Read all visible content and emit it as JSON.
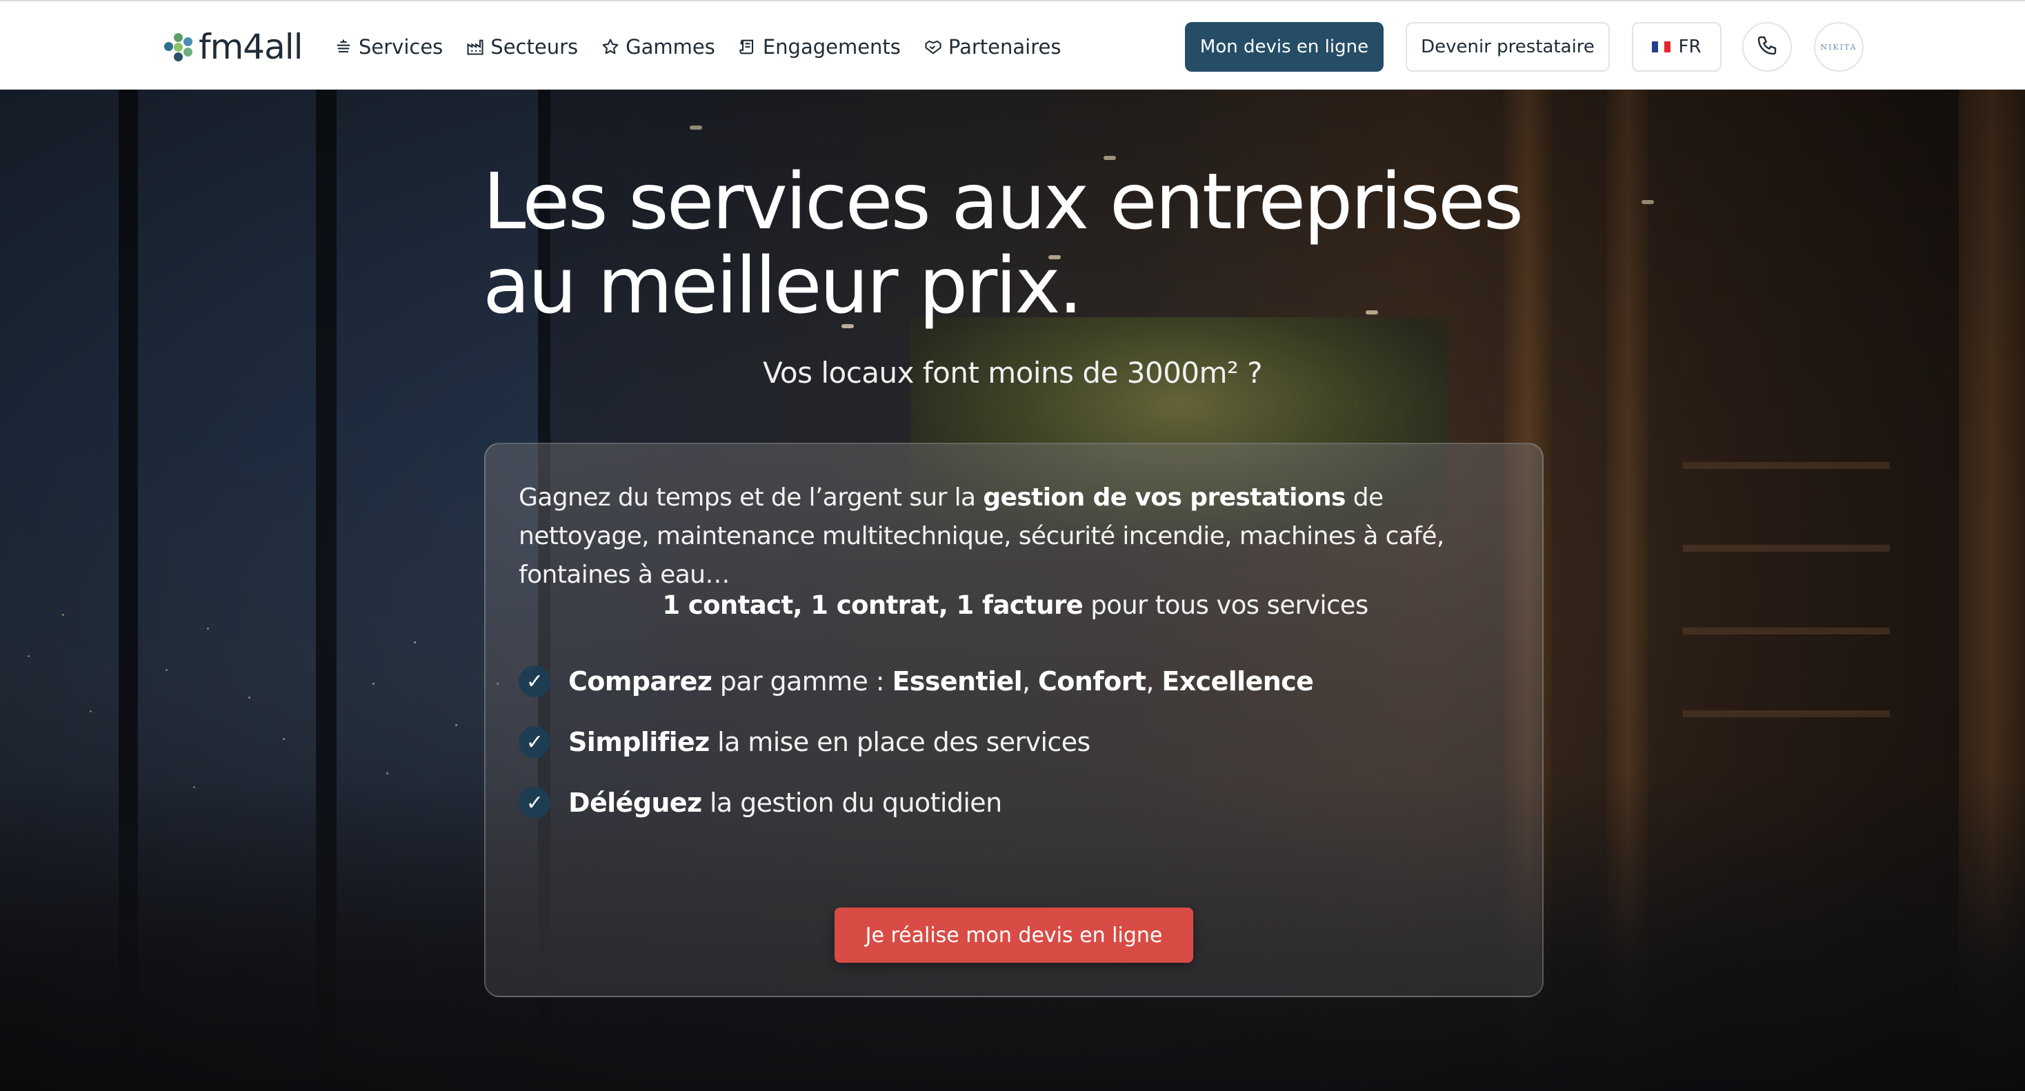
{
  "brand": {
    "name": "fm4all",
    "dot_colors": [
      "#2f6f8f",
      "#5c9f6a",
      "#8cc36a",
      "#2a4e6a",
      "#4c8fb0",
      "#6bb07a",
      "#1f3a52"
    ]
  },
  "nav": {
    "items": [
      {
        "label": "Services",
        "icon": "broom-icon"
      },
      {
        "label": "Secteurs",
        "icon": "factory-icon"
      },
      {
        "label": "Gammes",
        "icon": "star-icon"
      },
      {
        "label": "Engagements",
        "icon": "scroll-icon"
      },
      {
        "label": "Partenaires",
        "icon": "handshake-icon"
      }
    ]
  },
  "header_actions": {
    "quote_label": "Mon devis en ligne",
    "provider_label": "Devenir prestataire",
    "lang_label": "FR",
    "phone_icon": "phone-icon",
    "avatar_text": "NIKITA"
  },
  "hero": {
    "title_line1": "Les services aux entreprises",
    "title_line2": "au meilleur prix.",
    "subtitle": "Vos locaux font moins de 3000m² ?",
    "intro_part1": "Gagnez du temps et de l’argent sur la ",
    "intro_bold": "gestion de vos prestations",
    "intro_part2": " de nettoyage, maintenance multitechnique, sécurité incendie, machines à café, fontaines à eau…",
    "tagline_bold": "1 contact, 1 contrat, 1 facture",
    "tagline_rest": " pour tous vos services",
    "benefits": [
      {
        "bold": "Comparez",
        "rest": " par gamme : ",
        "extra_bold1": "Essentiel",
        "sep1": ", ",
        "extra_bold2": "Confort",
        "sep2": ", ",
        "extra_bold3": "Excellence"
      },
      {
        "bold": "Simplifiez",
        "rest": " la mise en place des services"
      },
      {
        "bold": "Déléguez",
        "rest": " la gestion du quotidien"
      }
    ],
    "cta_label": "Je réalise mon devis en ligne"
  },
  "colors": {
    "primary": "#264d66",
    "cta": "#d84c45",
    "check_bg": "#1e3d52"
  }
}
